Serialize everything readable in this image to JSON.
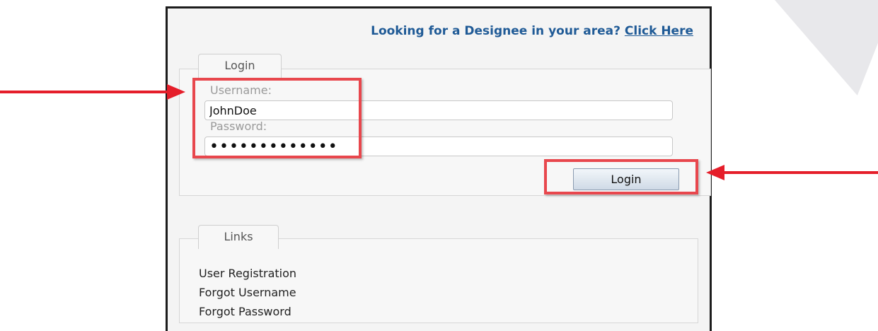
{
  "designee": {
    "prompt": "Looking for a Designee in your area?",
    "link_label": "Click Here"
  },
  "login_section": {
    "legend": "Login",
    "username_label": "Username:",
    "username_value": "JohnDoe",
    "password_label": "Password:",
    "password_value": "•••••••••••••",
    "button_label": "Login"
  },
  "links_section": {
    "legend": "Links",
    "items": [
      {
        "label": "User Registration"
      },
      {
        "label": "Forgot Username"
      },
      {
        "label": "Forgot Password"
      }
    ]
  },
  "annotations": {
    "highlight_color": "#e8474d",
    "arrow_color": "#e51e2a"
  },
  "theme": {
    "link_color": "#1f5a96",
    "panel_background": "#f4f4f4"
  }
}
